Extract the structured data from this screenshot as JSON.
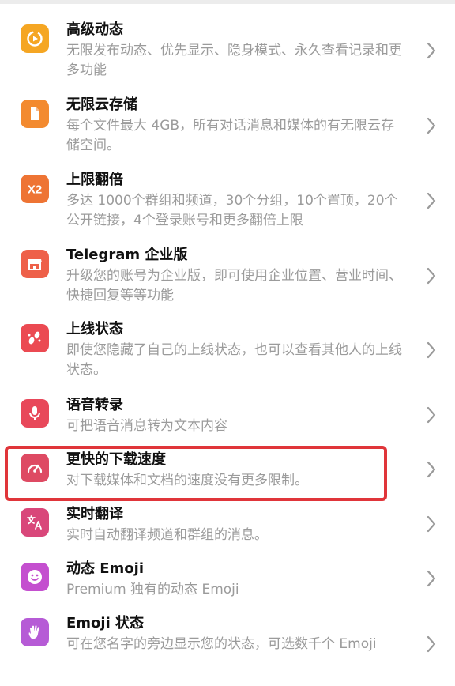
{
  "features": [
    {
      "title": "高级动态",
      "desc": "无限发布动态、优先显示、隐身模式、永久查看记录和更多功能",
      "icon": "story-play-icon",
      "color": "#f5a623"
    },
    {
      "title": "无限云存储",
      "desc": "每个文件最大 4GB，所有对话消息和媒体的有无限云存储空间。",
      "icon": "file-icon",
      "color": "#f38a2f"
    },
    {
      "title": "上限翻倍",
      "desc": "多达 1000个群组和频道，30个分组，10个置顶，20个公开链接，4个登录账号和更多翻倍上限",
      "icon": "x2-icon",
      "color": "#ee7434"
    },
    {
      "title": "Telegram 企业版",
      "desc": "升级您的账号为企业版，即可使用企业位置、营业时间、快捷回复等等功能",
      "icon": "shop-icon",
      "color": "#ee6049"
    },
    {
      "title": "上线状态",
      "desc": "即使您隐藏了自己的上线状态，也可以查看其他人的上线状态。",
      "icon": "footprints-icon",
      "color": "#eb4a52"
    },
    {
      "title": "语音转录",
      "desc": "可把语音消息转为文本内容",
      "icon": "microphone-icon",
      "color": "#e8485a"
    },
    {
      "title": "更快的下载速度",
      "desc": "对下载媒体和文档的速度没有更多限制。",
      "icon": "speedometer-icon",
      "color": "#de4a63"
    },
    {
      "title": "实时翻译",
      "desc": "实时自动翻译频道和群组的消息。",
      "icon": "translate-icon",
      "color": "#d9477a"
    },
    {
      "title": "动态 Emoji",
      "desc": "Premium 独有的动态 Emoji",
      "icon": "smile-emoji-icon",
      "color": "#c44fcf"
    },
    {
      "title": "Emoji 状态",
      "desc": "可在您名字的旁边显示您的状态，可选数千个 Emoji",
      "icon": "waving-hand-icon",
      "color": "#b65bd6"
    }
  ]
}
